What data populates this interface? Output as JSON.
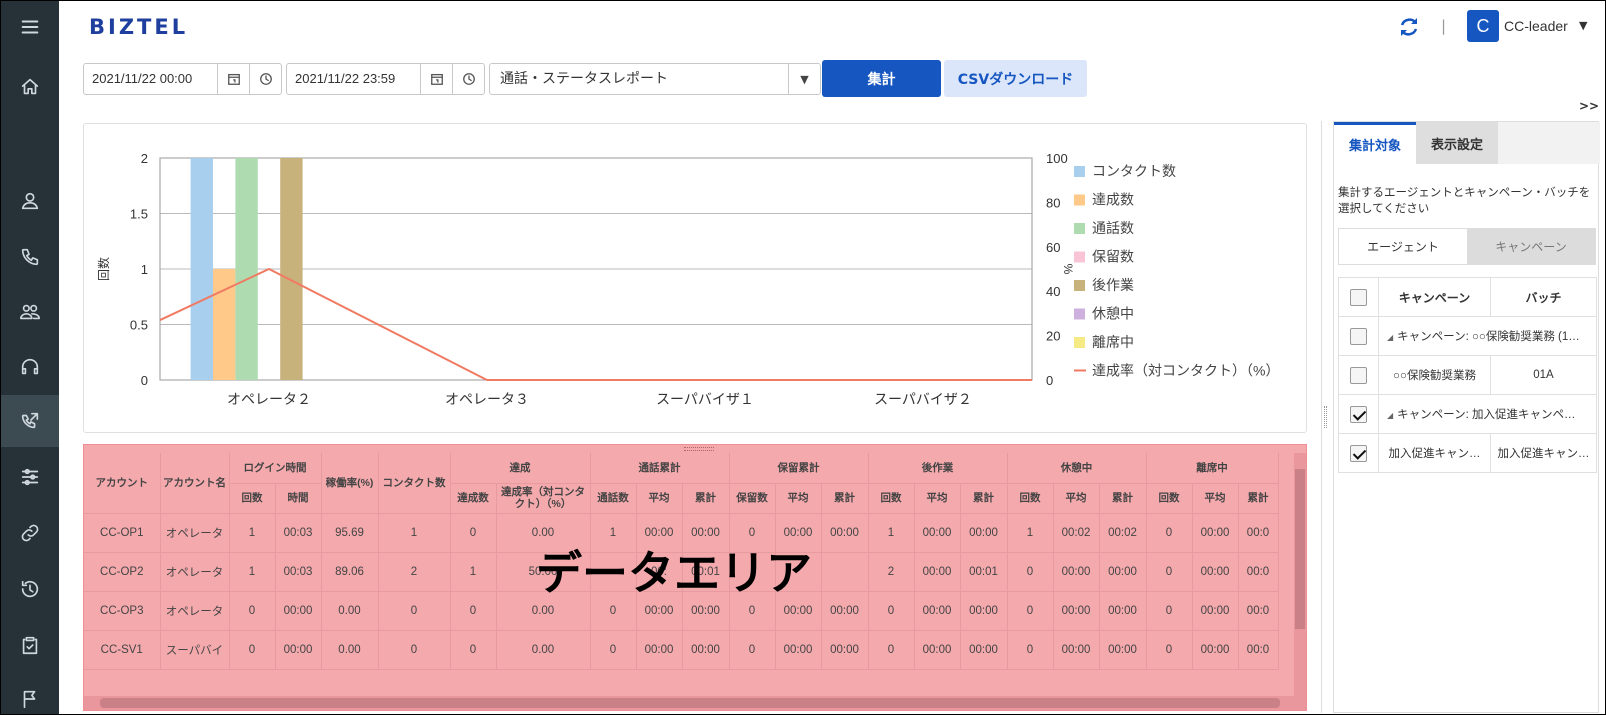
{
  "app": {
    "logo": "BIZTEL"
  },
  "header": {
    "user_initial": "C",
    "user_name": "CC-leader",
    "separator": "|"
  },
  "toolbar": {
    "start_datetime": "2021/11/22 00:00",
    "end_datetime": "2021/11/22 23:59",
    "report_type": "通話・ステータスレポート",
    "aggregate_label": "集計",
    "csv_label": "CSVダウンロード",
    "expand_label": ">>"
  },
  "chart_data": {
    "type": "bar",
    "categories": [
      "オペレータ２",
      "オペレータ３",
      "スーパバイザ１",
      "スーパバイザ２"
    ],
    "ylabel": "回数",
    "y2label": "%",
    "ylim": [
      0,
      2
    ],
    "yticks": [
      "0",
      "0.5",
      "1",
      "1.5",
      "2"
    ],
    "y2lim": [
      0,
      100
    ],
    "y2ticks": [
      "0",
      "20",
      "40",
      "60",
      "80",
      "100"
    ],
    "grid": true,
    "legend_position": "right",
    "series": [
      {
        "name": "コンタクト数",
        "color": "#a9cfee",
        "values": [
          2,
          0,
          0,
          0
        ]
      },
      {
        "name": "達成数",
        "color": "#ffc98a",
        "values": [
          1,
          0,
          0,
          0
        ]
      },
      {
        "name": "通話数",
        "color": "#aedcb0",
        "values": [
          2,
          0,
          0,
          0
        ]
      },
      {
        "name": "保留数",
        "color": "#f9c4d6",
        "values": [
          0,
          0,
          0,
          0
        ]
      },
      {
        "name": "後作業",
        "color": "#c7b27c",
        "values": [
          2,
          0,
          0,
          0
        ]
      },
      {
        "name": "休憩中",
        "color": "#cdb0dd",
        "values": [
          0,
          0,
          0,
          0
        ]
      },
      {
        "name": "離席中",
        "color": "#f5ea84",
        "values": [
          0,
          0,
          0,
          0
        ]
      }
    ],
    "line_series": {
      "name": "達成率（対コンタクト）（%）",
      "color": "#f07a62",
      "values": [
        50,
        0,
        0,
        0
      ],
      "left_edge_value": 27
    }
  },
  "data_area": {
    "overlay_label": "データエリア",
    "group_headers": [
      "アカウント",
      "アカウント名",
      "ログイン時間",
      "稼働率(%)",
      "コンタクト数",
      "達成",
      "通話累計",
      "保留累計",
      "後作業",
      "休憩中",
      "離席中"
    ],
    "sub_headers": {
      "login": [
        "回数",
        "時間"
      ],
      "achieve": [
        "達成数",
        "達成率（対コンタクト）（%）"
      ],
      "call": [
        "通話数",
        "平均",
        "累計"
      ],
      "hold": [
        "保留数",
        "平均",
        "累計"
      ],
      "after": [
        "回数",
        "平均",
        "累計"
      ],
      "break": [
        "回数",
        "平均",
        "累計"
      ],
      "away": [
        "回数",
        "平均",
        "累計"
      ]
    },
    "rows": [
      [
        "CC-OP1",
        "オペレータ",
        "1",
        "00:03",
        "95.69",
        "1",
        "0",
        "0.00",
        "1",
        "00:00",
        "00:00",
        "0",
        "00:00",
        "00:00",
        "1",
        "00:00",
        "00:00",
        "1",
        "00:02",
        "00:02",
        "0",
        "00:00",
        "00:0"
      ],
      [
        "CC-OP2",
        "オペレータ",
        "1",
        "00:03",
        "89.06",
        "2",
        "1",
        "50.00",
        "",
        "00:",
        "00:01",
        "",
        "",
        "",
        "2",
        "00:00",
        "00:01",
        "0",
        "00:00",
        "00:00",
        "0",
        "00:00",
        "00:0"
      ],
      [
        "CC-OP3",
        "オペレータ",
        "0",
        "00:00",
        "0.00",
        "0",
        "0",
        "0.00",
        "0",
        "00:00",
        "00:00",
        "0",
        "00:00",
        "00:00",
        "0",
        "00:00",
        "00:00",
        "0",
        "00:00",
        "00:00",
        "0",
        "00:00",
        "00:0"
      ],
      [
        "CC-SV1",
        "スーパバイ",
        "0",
        "00:00",
        "0.00",
        "0",
        "0",
        "0.00",
        "0",
        "00:00",
        "00:00",
        "0",
        "00:00",
        "00:00",
        "0",
        "00:00",
        "00:00",
        "0",
        "00:00",
        "00:00",
        "0",
        "00:00",
        "00:0"
      ]
    ]
  },
  "panel": {
    "tabs": [
      "集計対象",
      "表示設定"
    ],
    "description": "集計するエージェントとキャンペーン・バッチを選択してください",
    "sub_tabs": [
      "エージェント",
      "キャンペーン"
    ],
    "columns": [
      "キャンペーン",
      "バッチ"
    ],
    "rows": [
      {
        "checked": false,
        "group": true,
        "campaign": "キャンペーン: ○○保険勧奨業務 (1…",
        "batch": ""
      },
      {
        "checked": false,
        "group": false,
        "campaign": "○○保険勧奨業務",
        "batch": "01A"
      },
      {
        "checked": true,
        "group": true,
        "campaign": "キャンペーン: 加入促進キャンペ…",
        "batch": ""
      },
      {
        "checked": true,
        "group": false,
        "campaign": "加入促進キャン…",
        "batch": "加入促進キャン…"
      }
    ]
  },
  "icons": {
    "rail": [
      "menu-icon",
      "home-icon",
      "user-icon",
      "phone-icon",
      "group-icon",
      "headset-icon",
      "phone-forward-icon",
      "sliders-icon",
      "link-icon",
      "history-icon",
      "clipboard-icon",
      "flag-icon"
    ]
  }
}
